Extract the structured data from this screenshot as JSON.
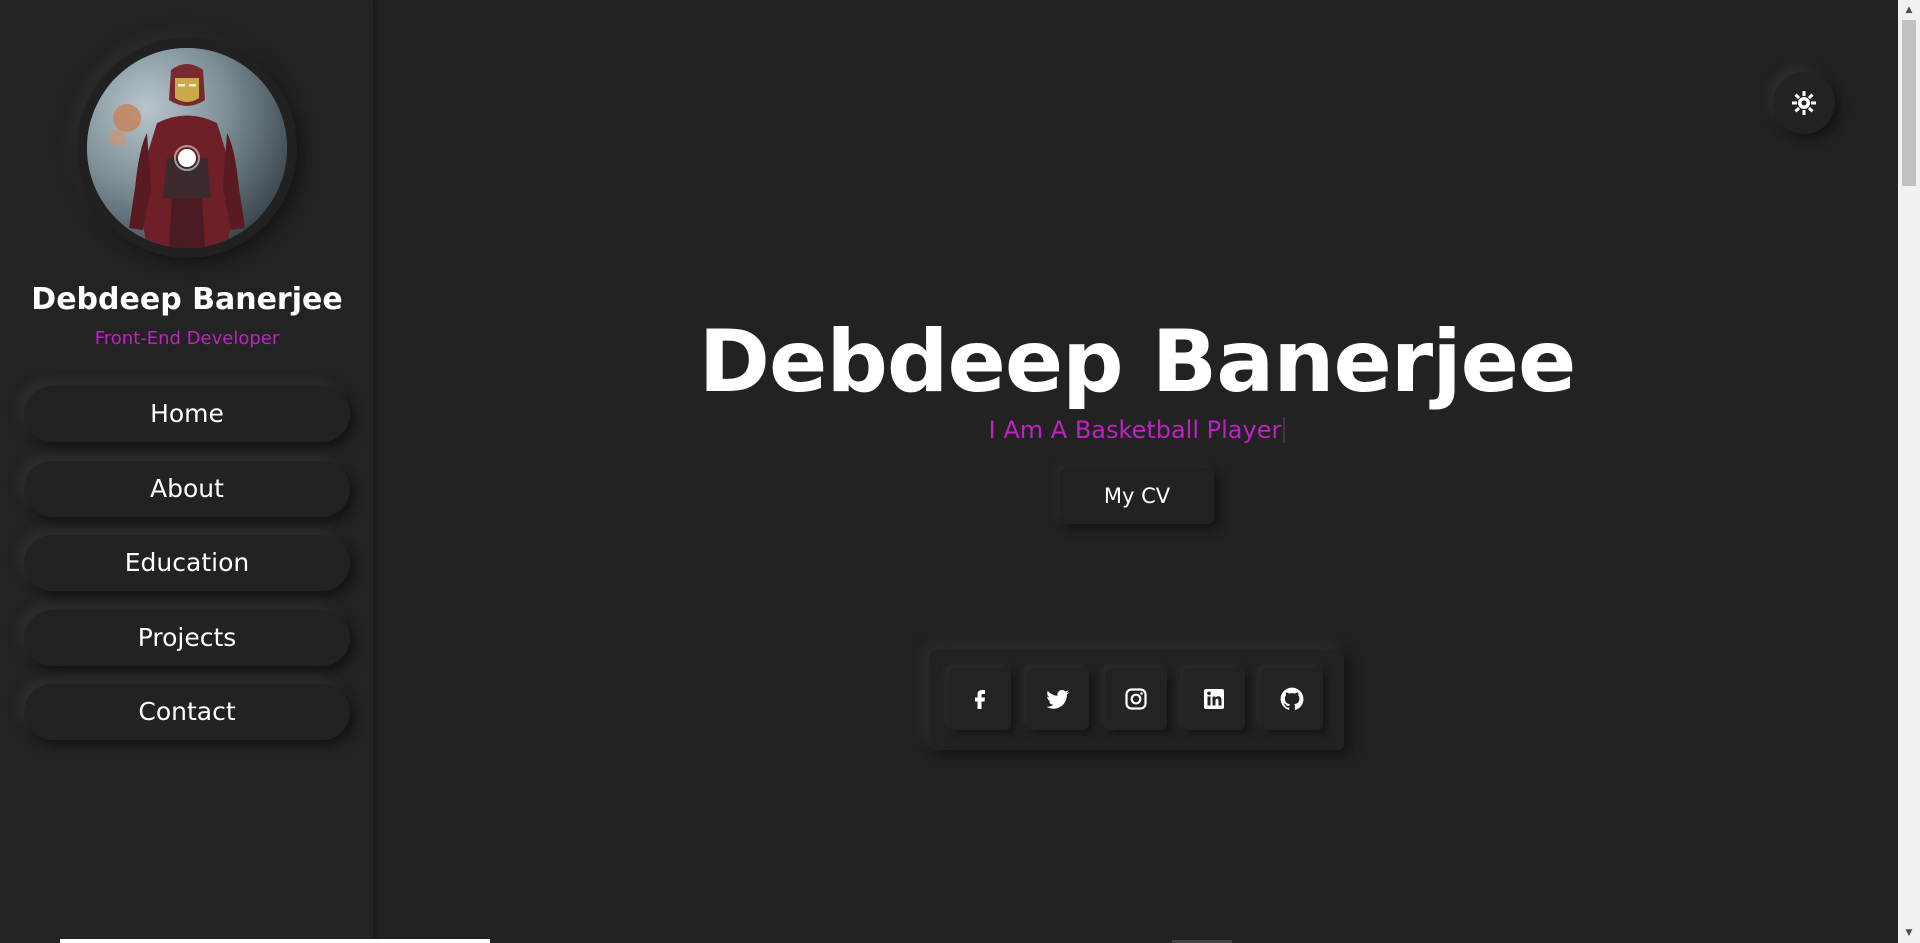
{
  "sidebar": {
    "name": "Debdeep Banerjee",
    "role": "Front-End Developer",
    "nav": [
      {
        "label": "Home"
      },
      {
        "label": "About"
      },
      {
        "label": "Education"
      },
      {
        "label": "Projects"
      },
      {
        "label": "Contact"
      }
    ]
  },
  "hero": {
    "name": "Debdeep Banerjee",
    "tagline": "I Am A Basketball Player",
    "cv_button": "My CV"
  },
  "theme_toggle": {
    "icon": "sun-icon"
  },
  "social": [
    {
      "icon": "facebook-icon"
    },
    {
      "icon": "twitter-icon"
    },
    {
      "icon": "instagram-icon"
    },
    {
      "icon": "linkedin-icon"
    },
    {
      "icon": "github-icon"
    }
  ],
  "colors": {
    "background": "#222222",
    "accent": "#c020c4",
    "text": "#ffffff"
  }
}
